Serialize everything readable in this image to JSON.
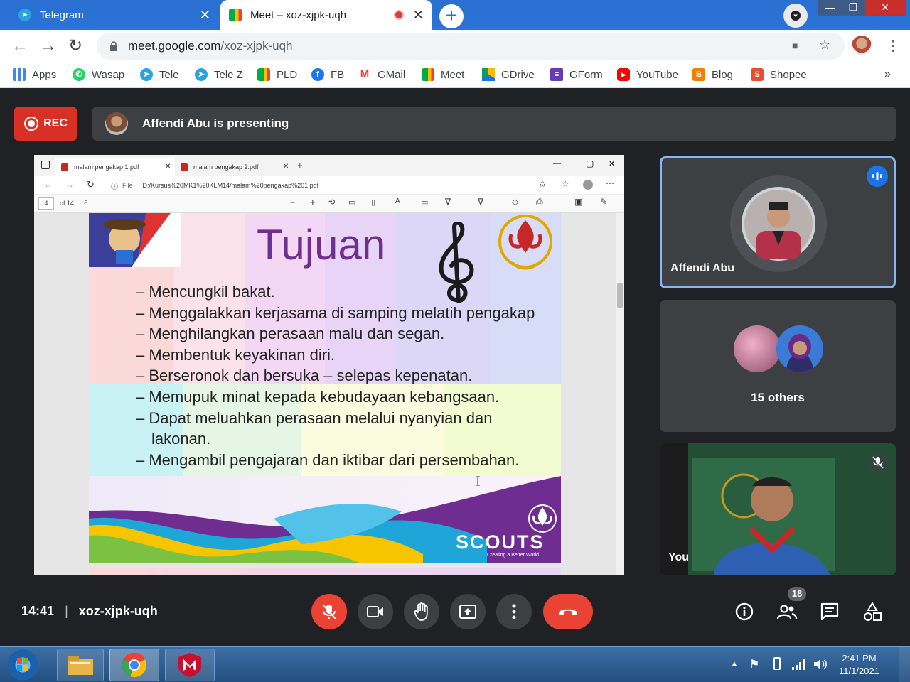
{
  "browser": {
    "tabs": [
      {
        "title": "Telegram",
        "close": "✕",
        "active": false
      },
      {
        "title": "Meet – xoz-xjpk-uqh",
        "close": "✕",
        "active": true
      }
    ],
    "new_tab": "+",
    "url_host": "meet.google.com",
    "url_path": "/xoz-xjpk-uqh",
    "window_buttons": [
      "—",
      "❐",
      "✕"
    ],
    "bookmarks": [
      {
        "label": "Apps",
        "icon": "apps-grid-icon",
        "color": "#4285f4"
      },
      {
        "label": "Wasap",
        "icon": "whatsapp-icon",
        "color": "#25d366"
      },
      {
        "label": "Tele",
        "icon": "telegram-icon",
        "color": "#2aa3e0"
      },
      {
        "label": "Tele Z",
        "icon": "telegram-icon",
        "color": "#2aa3e0"
      },
      {
        "label": "PLD",
        "icon": "meet-icon",
        "color": "#00ac47"
      },
      {
        "label": "FB",
        "icon": "facebook-icon",
        "color": "#1877f2"
      },
      {
        "label": "GMail",
        "icon": "gmail-icon",
        "color": "#ea4335"
      },
      {
        "label": "Meet",
        "icon": "meet-icon",
        "color": "#00ac47"
      },
      {
        "label": "GDrive",
        "icon": "drive-icon",
        "color": "#fbbc04"
      },
      {
        "label": "GForm",
        "icon": "forms-icon",
        "color": "#673ab7"
      },
      {
        "label": "YouTube",
        "icon": "youtube-icon",
        "color": "#ff0000"
      },
      {
        "label": "Blog",
        "icon": "blogger-icon",
        "color": "#f57d00"
      },
      {
        "label": "Shopee",
        "icon": "shopee-icon",
        "color": "#ee4d2d"
      }
    ],
    "bookmarks_more": "»"
  },
  "meet": {
    "rec_label": "REC",
    "presenting_text": "Affendi Abu is presenting",
    "meeting_code": "xoz-xjpk-uqh",
    "time": "14:41",
    "separator": "|",
    "people_count": "18",
    "accent": "#8ab4f8",
    "end_color": "#ea4335",
    "tiles": {
      "presenter": "Affendi Abu",
      "others": "15 others",
      "self": "You"
    }
  },
  "pdf": {
    "tabs": [
      {
        "title": "malam pengakap 1.pdf",
        "close": "✕"
      },
      {
        "title": "malam pengakap 2.pdf",
        "close": "✕"
      }
    ],
    "file_label": "File",
    "path": "D:/Kursus%20MK1%20KLM14/malam%20pengakap%201.pdf",
    "page": "4",
    "page_total": "of 14",
    "window_buttons": [
      "—",
      "▢",
      "✕"
    ]
  },
  "slide": {
    "title": "Tujuan",
    "bullets": [
      "Mencungkil bakat.",
      "Menggalakkan kerjasama di samping  melatih pengakap",
      "Menghilangkan perasaan malu dan segan.",
      "Membentuk keyakinan diri.",
      "Berseronok dan bersuka – selepas kepenatan.",
      "Memupuk minat kepada kebudayaan  kebangsaan.",
      "Dapat meluahkan perasaan melalui  nyanyian dan lakonan.",
      "Mengambil pengajaran dan iktibar dari persembahan."
    ],
    "brand": "SCOUTS",
    "tagline": "Creating a Better World"
  },
  "taskbar": {
    "time": "2:41 PM",
    "date": "11/1/2021"
  }
}
